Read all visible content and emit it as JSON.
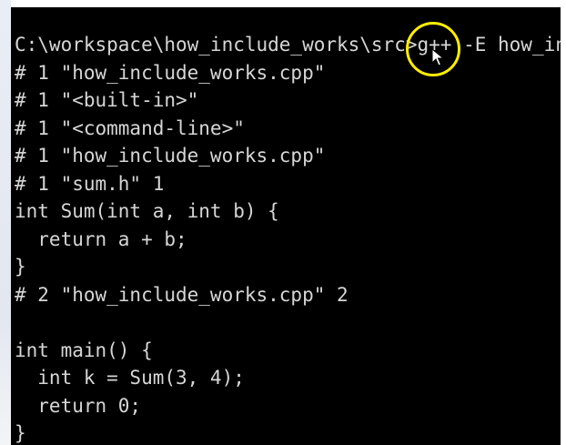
{
  "terminal": {
    "lines": [
      "C:\\workspace\\how_include_works\\src>g++ -E how_include_works.cpp",
      "# 1 \"how_include_works.cpp\"",
      "# 1 \"<built-in>\"",
      "# 1 \"<command-line>\"",
      "# 1 \"how_include_works.cpp\"",
      "# 1 \"sum.h\" 1",
      "int Sum(int a, int b) {",
      "  return a + b;",
      "}",
      "# 2 \"how_include_works.cpp\" 2",
      "",
      "int main() {",
      "  int k = Sum(3, 4);",
      "  return 0;",
      "}"
    ]
  },
  "colors": {
    "background": "#000000",
    "text": "#d6d6d6",
    "highlight_ring": "#ffee00"
  },
  "icons": {
    "cursor": "mouse-pointer-icon",
    "highlight": "cursor-highlight-ring"
  }
}
